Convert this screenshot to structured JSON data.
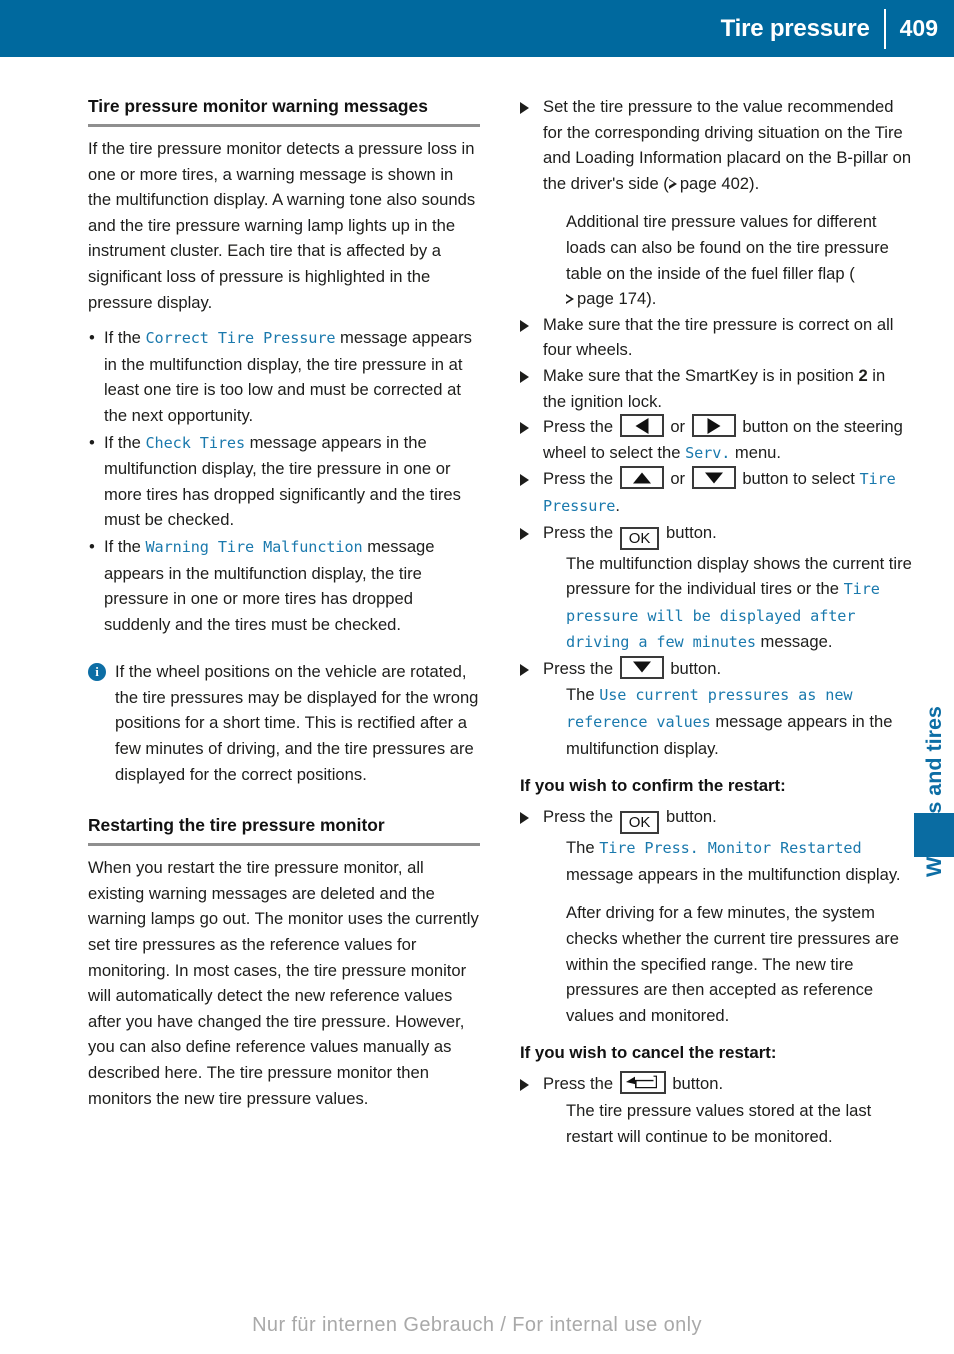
{
  "header": {
    "title": "Tire pressure",
    "page_number": "409",
    "bar_color": "#00699E"
  },
  "margin": {
    "chapter_label": "Wheels and tires",
    "tab_color": "#0A6CA2"
  },
  "footer": {
    "watermark": "Nur für internen Gebrauch / For internal use only"
  },
  "left_column": {
    "heading": "Tire pressure monitor warning messages",
    "intro": "If the tire pressure monitor detects a pressure loss in one or more tires, a warning message is shown in the multifunction display. A warning tone also sounds and the tire pressure warning lamp lights up in the instrument cluster. Each tire that is affected by a significant loss of pressure is highlighted in the pressure display.",
    "bullets": [
      {
        "lead": "If the ",
        "code": "Correct Tire Pressure",
        "tail": " message appears in the multifunction display, the tire pressure in at least one tire is too low and must be corrected at the next opportunity."
      },
      {
        "lead": "If the ",
        "code": "Check Tires",
        "tail": " message appears in the multifunction display, the tire pressure in one or more tires has dropped significantly and the tires must be checked."
      },
      {
        "lead": "If the ",
        "code": "Warning Tire Malfunction",
        "tail": " message appears in the multifunction display, the tire pressure in one or more tires has dropped suddenly and the tires must be checked."
      }
    ],
    "note": {
      "icon": "info-icon",
      "text": "If the wheel positions on the vehicle are rotated, the tire pressures may be displayed for the wrong positions for a short time. This is rectified after a few minutes of driving, and the tire pressures are displayed for the correct positions."
    },
    "heading2": "Restarting the tire pressure monitor",
    "body2": "When you restart the tire pressure monitor, all existing warning messages are deleted and the warning lamps go out. The monitor uses the currently set tire pressures as the reference values for monitoring. In most cases, the tire pressure monitor will automatically detect the new reference values after you have changed the tire pressure. However, you can also define reference values manually as described here. The tire pressure monitor then monitors the new tire pressure values."
  },
  "right_column": {
    "step1": {
      "text_a": "Set the tire pressure to the value recommended for the corresponding driving situation on the Tire and Loading Information placard on the B-pillar on the driver's side (",
      "xref_a": "page 402",
      "text_b": ").",
      "follow_a": "Additional tire pressure values for different loads can also be found on the tire pressure table on the inside of the fuel filler flap (",
      "xref_b": "page 174",
      "follow_b": ")."
    },
    "step2": "Make sure that the tire pressure is correct on all four wheels.",
    "step3": {
      "pre": "Make sure that the SmartKey is in position ",
      "bold": "2",
      "post": " in the ignition lock."
    },
    "step4": {
      "pre": "Press the ",
      "key_left": "arrow-left-button",
      "mid": " or ",
      "key_right": "arrow-right-button",
      "post": " button on the steering wheel to select the ",
      "code": "Serv.",
      "tail": " menu."
    },
    "step5": {
      "pre": "Press the ",
      "key_up": "arrow-up-button",
      "mid": " or ",
      "key_down": "arrow-down-button",
      "post": " button to select ",
      "code": "Tire Pressure",
      "tail": "."
    },
    "step6": {
      "pre": "Press the ",
      "key_ok": "OK",
      "post": " button.",
      "result_a": "The multifunction display shows the current tire pressure for the individual tires or the ",
      "result_code": "Tire pressure will be displayed after driving a few minutes",
      "result_b": " message."
    },
    "step7": {
      "pre": "Press the ",
      "key_down": "arrow-down-button",
      "post": " button.",
      "result_a": "The ",
      "result_code": "Use current pressures as new reference values",
      "result_b": " message appears in the multifunction display."
    },
    "subhead_confirm": "If you wish to confirm the restart:",
    "step8": {
      "pre": "Press the ",
      "key_ok": "OK",
      "post": " button.",
      "result_a": "The ",
      "result_code": "Tire Press. Monitor Restarted",
      "result_b": " message appears in the multifunction display.",
      "result_c": "After driving for a few minutes, the system checks whether the current tire pressures are within the specified range. The new tire pressures are then accepted as reference values and monitored."
    },
    "subhead_cancel": "If you wish to cancel the restart:",
    "step9": {
      "pre": "Press the ",
      "key_back": "back-button",
      "post": " button.",
      "result_a": "The tire pressure values stored at the last restart will continue to be monitored."
    }
  }
}
